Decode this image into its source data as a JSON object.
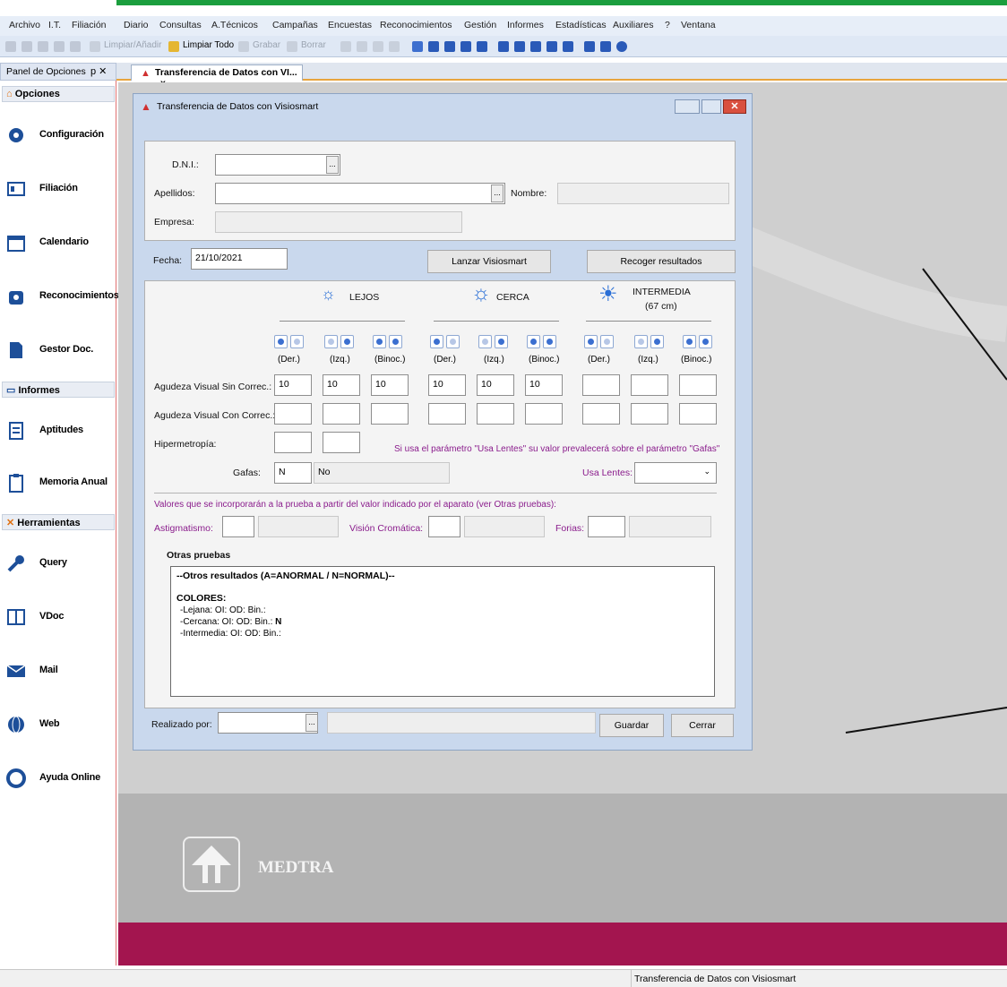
{
  "menu": [
    "Archivo",
    "I.T.",
    "Filiación",
    "Diario",
    "Consultas",
    "A.Técnicos",
    "Campañas",
    "Encuestas",
    "Reconocimientos",
    "Gestión",
    "Informes",
    "Estadísticas",
    "Auxiliares",
    "?",
    "Ventana"
  ],
  "toolbar": {
    "limpiar_anadir": "Limpiar/Añadir",
    "limpiar_todo": "Limpiar Todo",
    "grabar": "Grabar",
    "borrar": "Borrar"
  },
  "panel": {
    "title": "Panel de Opciones",
    "pin": "p ✕"
  },
  "sections": {
    "opciones": "Opciones",
    "informes": "Informes",
    "herramientas": "Herramientas"
  },
  "nav": {
    "configuracion": "Configuración",
    "filiacion": "Filiación",
    "calendario": "Calendario",
    "reconocimientos": "Reconocimientos",
    "gestor": "Gestor Doc.",
    "aptitudes": "Aptitudes",
    "memoria": "Memoria Anual",
    "query": "Query",
    "vdoc": "VDoc",
    "mail": "Mail",
    "web": "Web",
    "ayuda": "Ayuda Online"
  },
  "tab": {
    "label": "Transferencia de Datos con VI...",
    "close": "x"
  },
  "dialog": {
    "title": "Transferencia de Datos con Visiosmart",
    "dni_label": "D.N.I.:",
    "apellidos_label": "Apellidos:",
    "nombre_label": "Nombre:",
    "empresa_label": "Empresa:",
    "fecha_label": "Fecha:",
    "fecha_value": "21/10/2021",
    "lanzar": "Lanzar Visiosmart",
    "recoger": "Recoger resultados",
    "lejos": "LEJOS",
    "cerca": "CERCA",
    "intermedia": "INTERMEDIA",
    "intermedia_sub": "(67 cm)",
    "der": "(Der.)",
    "izq": "(Izq.)",
    "binoc": "(Binoc.)",
    "av_sin": "Agudeza Visual Sin Correc.:",
    "av_con": "Agudeza Visual Con Correc.:",
    "hiper": "Hipermetropía:",
    "av_sin_values": [
      "10",
      "10",
      "10",
      "10",
      "10",
      "10",
      "",
      "",
      ""
    ],
    "usa_lentes_note": "Si usa el parámetro \"Usa Lentes\" su valor prevalecerá sobre el parámetro \"Gafas\"",
    "gafas_label": "Gafas:",
    "gafas_code": "N",
    "gafas_desc": "No",
    "usa_lentes_label": "Usa Lentes:",
    "valores_note": "Valores que se incorporarán a la prueba a partir del valor indicado por el aparato (ver Otras pruebas):",
    "astig": "Astigmatismo:",
    "vision": "Visión Cromática:",
    "forias": "Forias:",
    "otras": "Otras pruebas",
    "otras_line1": "--Otros resultados (A=ANORMAL / N=NORMAL)--",
    "colores": "COLORES:",
    "lejana": "-Lejana: OI:  OD:  Bin.:",
    "cercana": "-Cercana: OI:  OD:  Bin.: ",
    "cercana_val": "N",
    "intermedia_line": "-Intermedia: OI:  OD:  Bin.:",
    "realizado": "Realizado por:",
    "guardar": "Guardar",
    "cerrar": "Cerrar"
  },
  "brand": "MEDTRA",
  "status": "Transferencia de Datos con Visiosmart"
}
